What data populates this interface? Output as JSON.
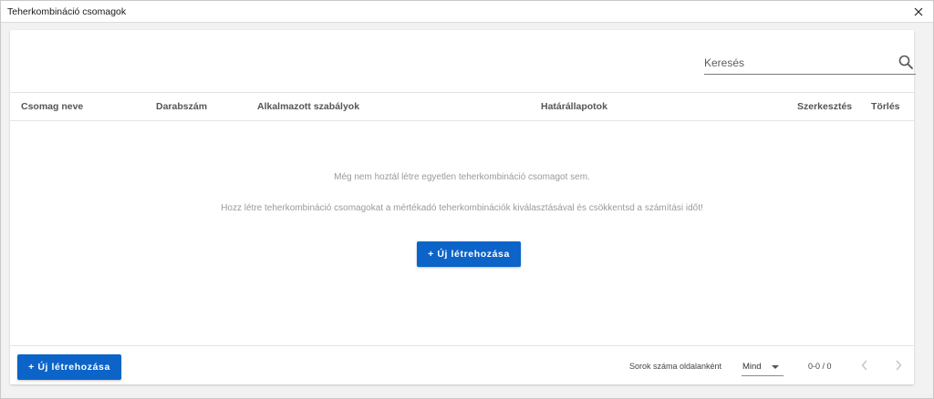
{
  "window": {
    "title": "Teherkombináció csomagok"
  },
  "search": {
    "placeholder": "Keresés"
  },
  "table": {
    "columns": [
      "Csomag neve",
      "Darabszám",
      "Alkalmazott szabályok",
      "Határállapotok",
      "Szerkesztés",
      "Törlés"
    ]
  },
  "empty_state": {
    "message": "Még nem hoztál létre egyetlen teherkombináció csomagot sem.",
    "hint": "Hozz létre teherkombináció csomagokat a mértékadó teherkombinációk kiválasztásával és csökkentsd a számítási időt!",
    "create_label": "+ Új létrehozása"
  },
  "footer": {
    "create_label": "+ Új létrehozása",
    "rows_per_page_label": "Sorok száma oldalanként",
    "rows_per_page_value": "Mind",
    "range": "0-0 / 0"
  },
  "colors": {
    "primary": "#0c64c9"
  },
  "icons": {
    "close": "close-icon",
    "search": "search-icon",
    "prev": "chevron-left-icon",
    "next": "chevron-right-icon",
    "dropdown": "caret-down-icon"
  }
}
